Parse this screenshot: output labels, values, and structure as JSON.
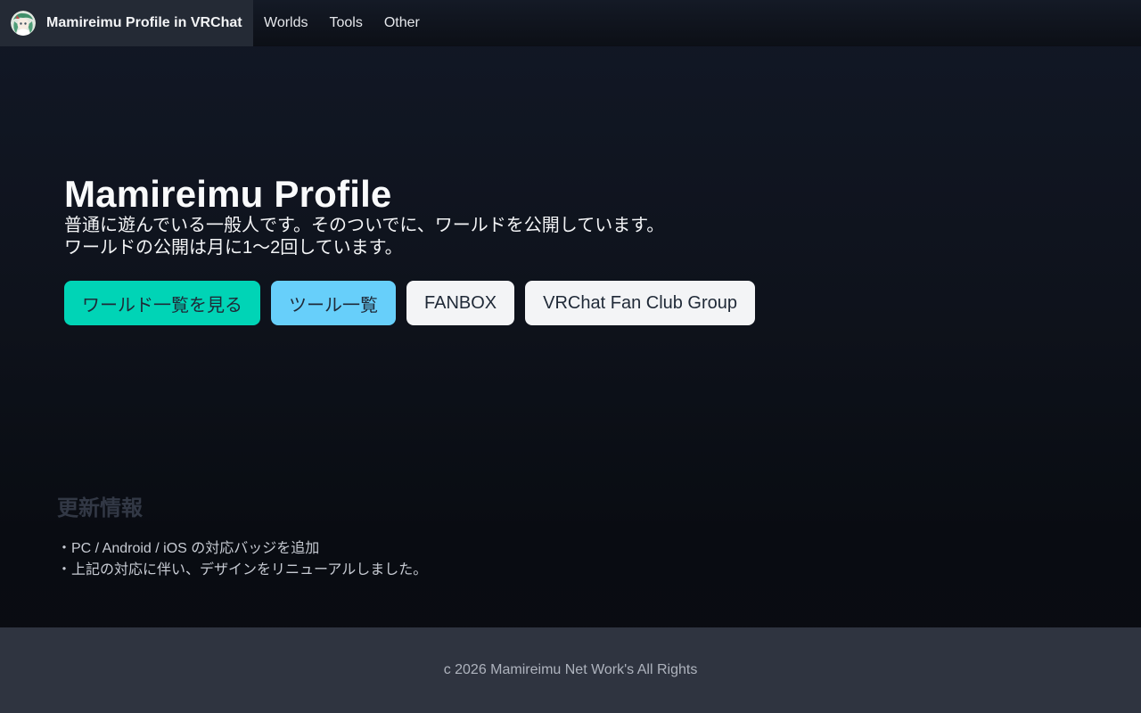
{
  "navbar": {
    "brand_title": "Mamireimu Profile in VRChat",
    "links": [
      "Worlds",
      "Tools",
      "Other"
    ]
  },
  "hero": {
    "title": "Mamireimu Profile",
    "description_lines": [
      "普通に遊んでいる一般人です。そのついでに、ワールドを公開しています。",
      "ワールドの公開は月に1～2回しています。"
    ],
    "buttons": [
      {
        "label": "ワールド一覧を見る",
        "color": "#00d4b6"
      },
      {
        "label": "ツール一覧",
        "color": "#67cffa"
      },
      {
        "label": "FANBOX",
        "color": "#f3f4f6"
      },
      {
        "label": "VRChat Fan Club Group",
        "color": "#f3f4f6"
      }
    ]
  },
  "updates": {
    "title": "更新情報",
    "items": [
      "・PC / Android / iOS の対応バッジを追加",
      "・上記の対応に伴い、デザインをリニューアルしました。"
    ]
  },
  "footer": {
    "text": "c 2026 Mamireimu Net Work's All Rights"
  },
  "colors": {
    "background": "#0c0f16",
    "brand_bg": "#242a35",
    "footer_bg": "#2f3440",
    "accent_teal": "#00d4b6",
    "accent_sky": "#67cffa"
  },
  "icons": {
    "avatar": "avatar-image"
  }
}
